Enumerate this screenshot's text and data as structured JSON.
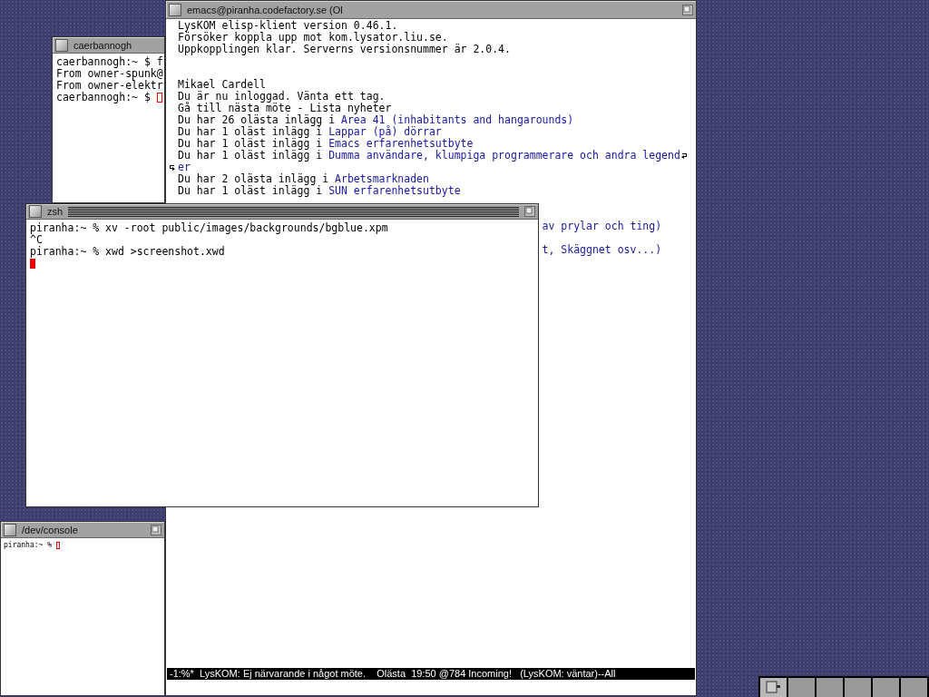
{
  "windows": [
    {
      "kind": "term",
      "title": "caerbannogh",
      "focused": false,
      "lines": [
        "caerbannogh:~ $ f",
        "From owner-spunk@",
        "From owner-elektr",
        "caerbannogh:~ $ "
      ]
    },
    {
      "kind": "console",
      "title": "/dev/console",
      "focused": false,
      "lines": [
        "piranha:~ % "
      ]
    },
    {
      "kind": "emacs",
      "title": "emacs@piranha.codefactory.se (Ol",
      "focused": false,
      "lines": [
        {
          "kind": "text",
          "parts": [
            {
              "text": "LysKOM elisp-klient version 0.46.1.",
              "link": false
            }
          ]
        },
        {
          "kind": "text",
          "parts": [
            {
              "text": "Försöker koppla upp mot kom.lysator.liu.se.",
              "link": false
            }
          ]
        },
        {
          "kind": "text",
          "parts": [
            {
              "text": "Uppkopplingen klar. Serverns versionsnummer är 2.0.4.",
              "link": false
            }
          ]
        },
        {
          "kind": "blank"
        },
        {
          "kind": "blank"
        },
        {
          "kind": "text",
          "parts": [
            {
              "text": "Mikael Cardell",
              "link": false
            }
          ]
        },
        {
          "kind": "text",
          "parts": [
            {
              "text": "Du är nu inloggad. Vänta ett tag.",
              "link": false
            }
          ]
        },
        {
          "kind": "text",
          "parts": [
            {
              "text": "Gå till nästa möte - Lista nyheter",
              "link": false
            }
          ]
        },
        {
          "kind": "text",
          "parts": [
            {
              "text": "Du har 26 olästa inlägg i ",
              "link": false
            },
            {
              "text": "Area 41 (inhabitants and hangarounds)",
              "link": true
            }
          ]
        },
        {
          "kind": "text",
          "parts": [
            {
              "text": "Du har 1 oläst inlägg i ",
              "link": false
            },
            {
              "text": "Lappar (på) dörrar",
              "link": true
            }
          ]
        },
        {
          "kind": "text",
          "parts": [
            {
              "text": "Du har 1 oläst inlägg i ",
              "link": false
            },
            {
              "text": "Emacs erfarenhetsutbyte",
              "link": true
            }
          ]
        },
        {
          "kind": "continued",
          "parts": [
            {
              "text": "Du har 1 oläst inlägg i ",
              "link": false
            },
            {
              "text": "Dumma användare, klumpiga programmerare och andra legend",
              "link": true
            }
          ]
        },
        {
          "kind": "continuation",
          "parts": [
            {
              "text": "er",
              "link": true
            }
          ]
        },
        {
          "kind": "text",
          "parts": [
            {
              "text": "Du har 2 olästa inlägg i ",
              "link": false
            },
            {
              "text": "Arbetsmarknaden",
              "link": true
            }
          ]
        },
        {
          "kind": "text",
          "parts": [
            {
              "text": "Du har 1 oläst inlägg i ",
              "link": false
            },
            {
              "text": "SUN erfarenhetsutbyte",
              "link": true
            }
          ]
        },
        {
          "kind": "blank"
        },
        {
          "kind": "blank"
        },
        {
          "kind": "fragment",
          "parts": [
            {
              "text": "av prylar och ting)",
              "link": true
            }
          ]
        },
        {
          "kind": "blank"
        },
        {
          "kind": "fragment",
          "parts": [
            {
              "text": "t, Skäggnet osv...)",
              "link": true
            }
          ]
        }
      ],
      "mode_line": "-1:%*  LysKOM: Ej närvarande i något möte.    Olästa  19:50 @784 Incoming!   (LysKOM: väntar)--All"
    },
    {
      "kind": "term",
      "title": "zsh",
      "focused": true,
      "lines": [
        "piranha:~ % xv -root public/images/backgrounds/bgblue.xpm",
        "^C",
        "piranha:~ % xwd >screenshot.xwd"
      ]
    }
  ],
  "pager": {
    "desks": [
      {
        "selected": true
      },
      {
        "selected": false
      },
      {
        "selected": false
      },
      {
        "selected": false
      },
      {
        "selected": false
      },
      {
        "selected": false
      }
    ]
  }
}
